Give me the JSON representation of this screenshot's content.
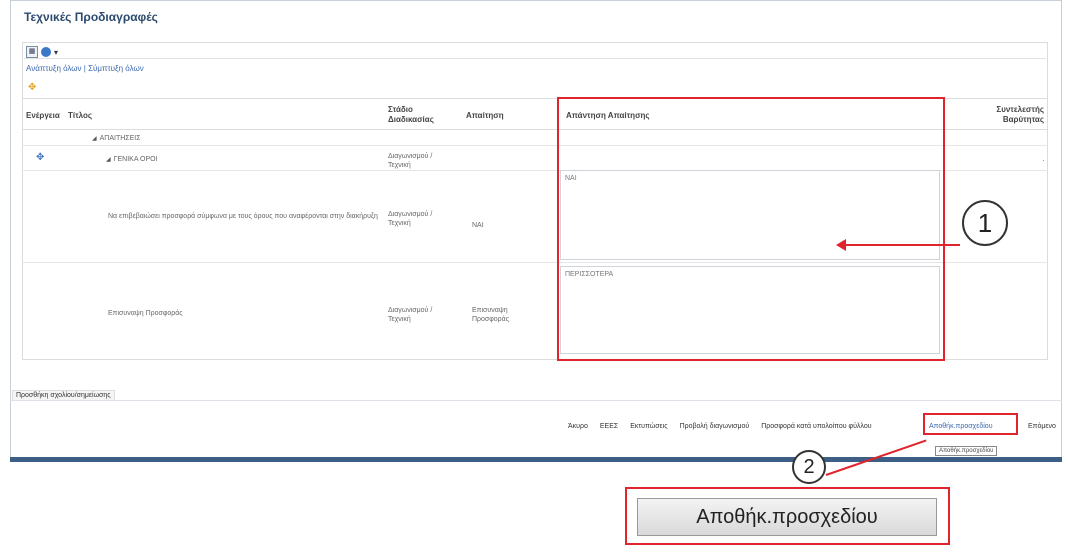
{
  "section_title": "Τεχνικές Προδιαγραφές",
  "toolbar": {
    "view_icon": "table-view-icon",
    "settings_icon": "gear-icon",
    "dropdown_icon": "chevron-down-icon",
    "links": "Ανάπτυξη όλων | Σύμπτυξη όλων"
  },
  "add_icon": "add-row-icon",
  "table": {
    "headers": {
      "action": "Ενέργεια",
      "title": "Τίτλος",
      "stage": "Στάδιο Διαδικασίας",
      "answer": "Απαίτηση",
      "response": "Απάντηση Απαίτησης",
      "criteria": "Συντελεστής Βαρύτητας"
    },
    "rows": [
      {
        "title": "ΑΠΑΙΤΗΣΕΙΣ",
        "stage": "",
        "answer": ""
      },
      {
        "title": "ΓΕΝΙΚΑ ΟΡΟΙ",
        "stage": "Διαγωνισμού / Τεχνική",
        "answer": ""
      },
      {
        "title": "Να επιβεβαιώσει προσφορά σύμφωνα με τους όρους που αναφέρονται στην διακήρυξη",
        "stage": "Διαγωνισμού / Τεχνική",
        "answer": "ΝΑΙ"
      },
      {
        "title": "Επισυναψη Προσφοράς",
        "stage": "Διαγωνισμού / Τεχνική",
        "answer": "Επισυναψη Προσφοράς"
      }
    ],
    "responses": [
      "ΝΑΙ",
      "ΠΕΡΙΣΣΟΤΕΡΑ"
    ]
  },
  "annotations": {
    "marker1": "1",
    "marker2": "2",
    "highlight_color": "#e0242c"
  },
  "footer": {
    "add_comment": "Προσθήκη σχολίου/σημείωσης",
    "buttons": [
      "Άκυρο",
      "ΕΕΕΣ",
      "Εκτυπώσεις",
      "Προβολή διαγωνισμού",
      "Προσφορά κατά υπολοίπου φύλλου",
      "Αποθήκ.προσχεδίου",
      "Επόμενο"
    ],
    "tooltip": "Αποθήκ.προσχεδίου"
  },
  "zoomed_button_label": "Αποθήκ.προσχεδίου"
}
